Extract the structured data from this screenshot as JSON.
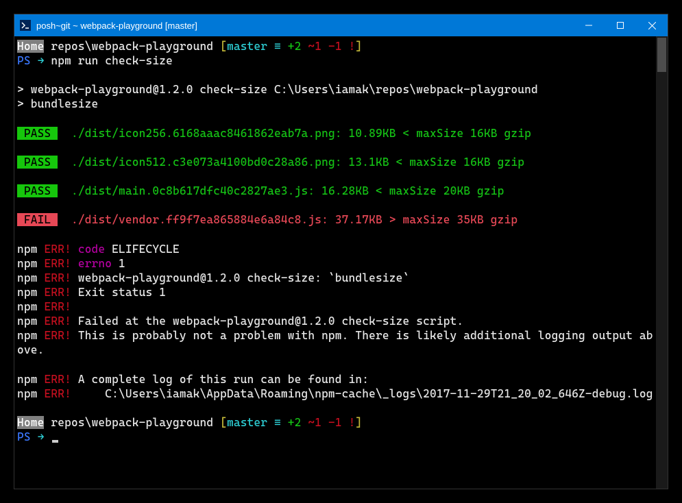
{
  "window": {
    "title": "posh~git ~ webpack-playground [master]"
  },
  "prompt1": {
    "home": "Home",
    "path": "repos\\webpack-playground",
    "branch_open": "[",
    "branch": "master",
    "equiv": " ≡",
    "plus": " +2",
    "tilde": " ~1",
    "minus": " -1",
    "bang": " !",
    "branch_close": "]",
    "ps": "PS",
    "arrow": " → ",
    "command": "npm run check-size"
  },
  "npm_header": {
    "line1": "> webpack-playground@1.2.0 check-size C:\\Users\\iamak\\repos\\webpack-playground",
    "line2": "> bundlesize"
  },
  "results": [
    {
      "status": " PASS ",
      "pass": true,
      "file": "./dist/icon256.6168aaac8461862eab7a.png: 10.89KB < maxSize 16KB gzip"
    },
    {
      "status": " PASS ",
      "pass": true,
      "file": "./dist/icon512.c3e073a4100bd0c28a86.png: 13.1KB < maxSize 16KB gzip"
    },
    {
      "status": " PASS ",
      "pass": true,
      "file": "./dist/main.0c8b617dfc40c2827ae3.js: 16.28KB < maxSize 20KB gzip"
    },
    {
      "status": " FAIL ",
      "pass": false,
      "file": "./dist/vendor.ff9f7ea865884e6a84c8.js: 37.17KB > maxSize 35KB gzip"
    }
  ],
  "errors": {
    "npm": "npm",
    "err": " ERR!",
    "code_label": " code",
    "code_value": " ELIFECYCLE",
    "errno_label": " errno",
    "errno_value": " 1",
    "script_line": " webpack-playground@1.2.0 check-size: `bundlesize`",
    "exit_line": " Exit status 1",
    "failed_line": " Failed at the webpack-playground@1.2.0 check-size script.",
    "prob_line": " This is probably not a problem with npm. There is likely additional logging output above.",
    "log_line": " A complete log of this run can be found in:",
    "log_path": "     C:\\Users\\iamak\\AppData\\Roaming\\npm-cache\\_logs\\2017-11-29T21_20_02_646Z-debug.log"
  },
  "prompt2": {
    "home": "Home",
    "path": "repos\\webpack-playground",
    "branch_open": "[",
    "branch": "master",
    "equiv": " ≡",
    "plus": " +2",
    "tilde": " ~1",
    "minus": " -1",
    "bang": " !",
    "branch_close": "]",
    "ps": "PS",
    "arrow": " → "
  }
}
